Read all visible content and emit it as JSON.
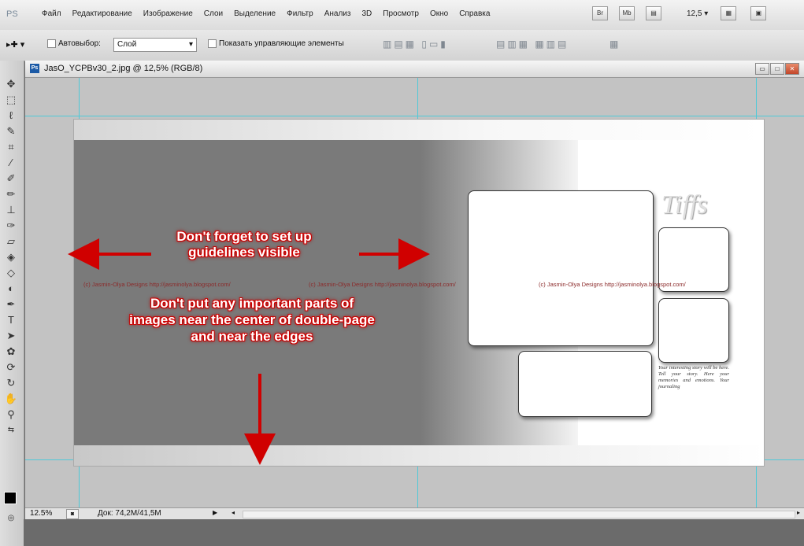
{
  "menubar": {
    "logo": "PS",
    "items": [
      "Файл",
      "Редактирование",
      "Изображение",
      "Слои",
      "Выделение",
      "Фильтр",
      "Анализ",
      "3D",
      "Просмотр",
      "Окно",
      "Справка"
    ],
    "btn_br": "Br",
    "btn_mb": "Mb",
    "zoom": "12,5 ▾"
  },
  "options": {
    "autoselect_label": "Автовыбор:",
    "autoselect_value": "Слой",
    "show_controls_label": "Показать управляющие элементы"
  },
  "document": {
    "title": "JasO_YCPBv30_2.jpg @ 12,5% (RGB/8)",
    "annotation_top": "Don't forget to set up guidelines visible",
    "annotation_bottom": "Don't put any important parts of images near the center of double-page and near the edges",
    "watermark1": "(c) Jasmin-Olya Designs http://jasminolya.blogspot.com/",
    "watermark2": "(c) Jasmin-Olya Designs http://jasminolya.blogspot.com/",
    "watermark3": "(c) Jasmin-Olya Designs http://jasminolya.blogspot.com/",
    "title_script": "Tiffs",
    "journal_text": "Your interesting story will be here. Tell your story. Here your memories and emotions. Your journaling"
  },
  "statusbar": {
    "zoom": "12.5%",
    "doc_info": "Док: 74,2M/41,5M"
  },
  "colors": {
    "guide": "#4fc9d8",
    "annotation": "#cc0000",
    "watermark": "#8b2a2a"
  }
}
